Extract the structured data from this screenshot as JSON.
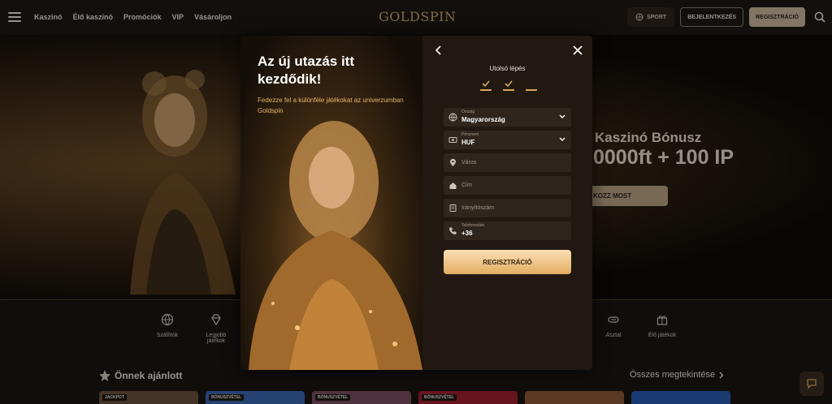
{
  "header": {
    "nav": [
      "Kaszinó",
      "Élő kaszinó",
      "Promóciók",
      "VIP",
      "Vásároljon"
    ],
    "logo": "GOLDSPIN",
    "sport_label": "SPORT",
    "login_label": "BEJELENTKEZÉS",
    "register_label": "REGISZTRÁCIÓ"
  },
  "hero": {
    "line1": "Kaszinó Bónusz",
    "line2": "0000ft + 100 IP",
    "button": "KOZZ MOST"
  },
  "categories": [
    {
      "label": "Szállítók",
      "icon": "globe-icon"
    },
    {
      "label": "Legjobb játékok",
      "icon": "diamond-icon"
    },
    {
      "label": "Asztal",
      "icon": "table-icon"
    },
    {
      "label": "Élő játékok",
      "icon": "gift-icon"
    }
  ],
  "recommended": {
    "title": "Önnek ajánlott",
    "see_all": "Összes megtekintése",
    "thumb_tags": [
      "JACKPOT",
      "BÓNUSZVÉTEL",
      "BÓNUSZVÉTEL",
      "BÓNUSZVÉTEL",
      "",
      ""
    ]
  },
  "modal": {
    "title": "Az új utazás itt kezdődik!",
    "subtitle": "Fedezze fel a különféle játékokat az univerzumban Goldspin",
    "step_title": "Utolsó lépés",
    "steps_completed": 2,
    "steps_total": 3,
    "fields": {
      "country_label": "Ország",
      "country_value": "Magyarország",
      "currency_label": "Pénznem",
      "currency_value": "HUF",
      "city_placeholder": "Város",
      "address_placeholder": "Cím",
      "zip_placeholder": "Irányítószám",
      "phone_label": "Telefonszám",
      "phone_value": "+36"
    },
    "submit": "REGISZTRÁCIÓ"
  },
  "colors": {
    "accent": "#d9a65a",
    "background": "#1a1511",
    "modal_panel": "#211812"
  }
}
